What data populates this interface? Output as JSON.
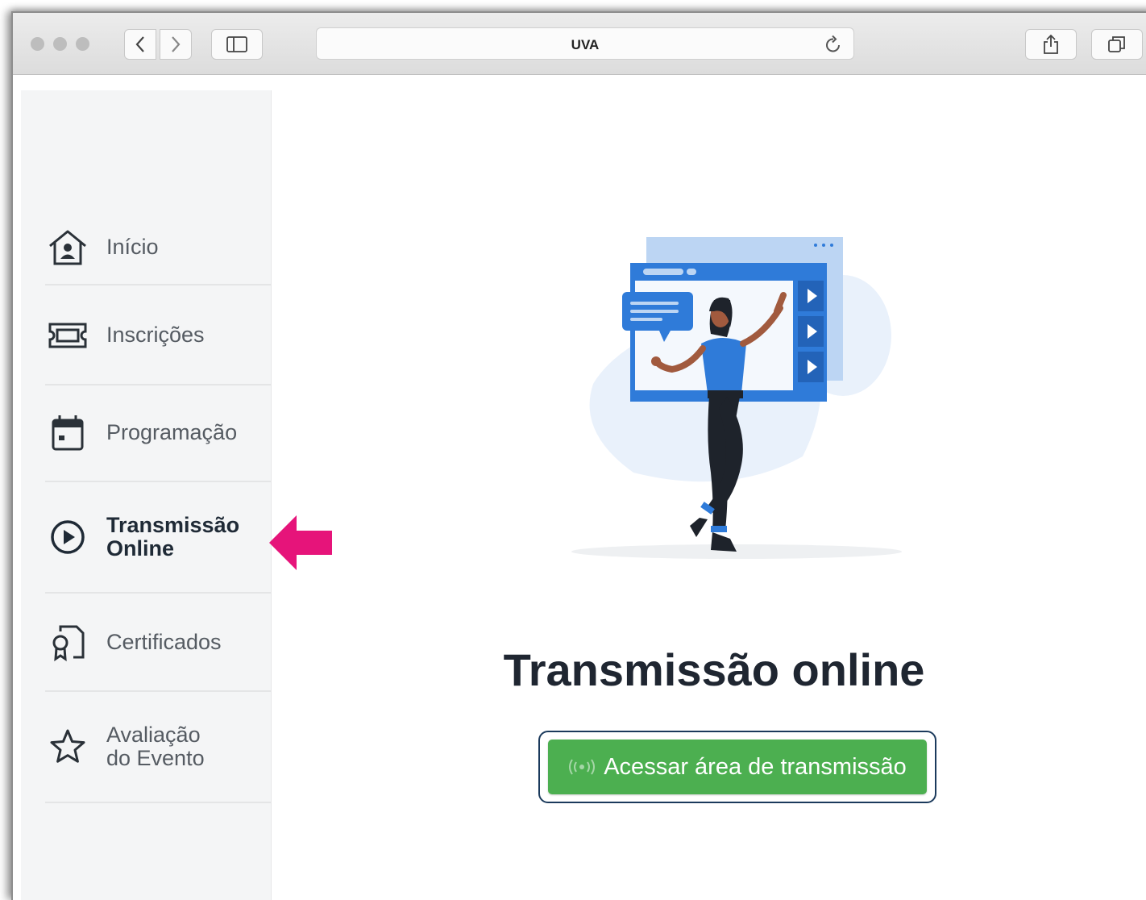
{
  "browser": {
    "url_title": "UVA",
    "icons": [
      "back-icon",
      "forward-icon",
      "sidebar-toggle-icon",
      "reload-icon",
      "share-icon",
      "tabs-icon"
    ]
  },
  "sidebar": {
    "items": [
      {
        "label": "Início",
        "icon": "home-icon",
        "active": false
      },
      {
        "label": "Inscrições",
        "icon": "ticket-icon",
        "active": false
      },
      {
        "label": "Programação",
        "icon": "calendar-icon",
        "active": false
      },
      {
        "label_line1": "Transmissão",
        "label_line2": "Online",
        "icon": "play-circle-icon",
        "active": true
      },
      {
        "label": "Certificados",
        "icon": "certificate-icon",
        "active": false
      },
      {
        "label_line1": "Avaliação",
        "label_line2": "do Evento",
        "icon": "star-icon",
        "active": false
      }
    ]
  },
  "main": {
    "title": "Transmissão online",
    "button_label": "Acessar área de transmissão",
    "button_icon": "broadcast-icon"
  },
  "colors": {
    "button": "#4caf50",
    "highlight_arrow": "#e6147a",
    "illustration_blue": "#2f7bd9"
  }
}
